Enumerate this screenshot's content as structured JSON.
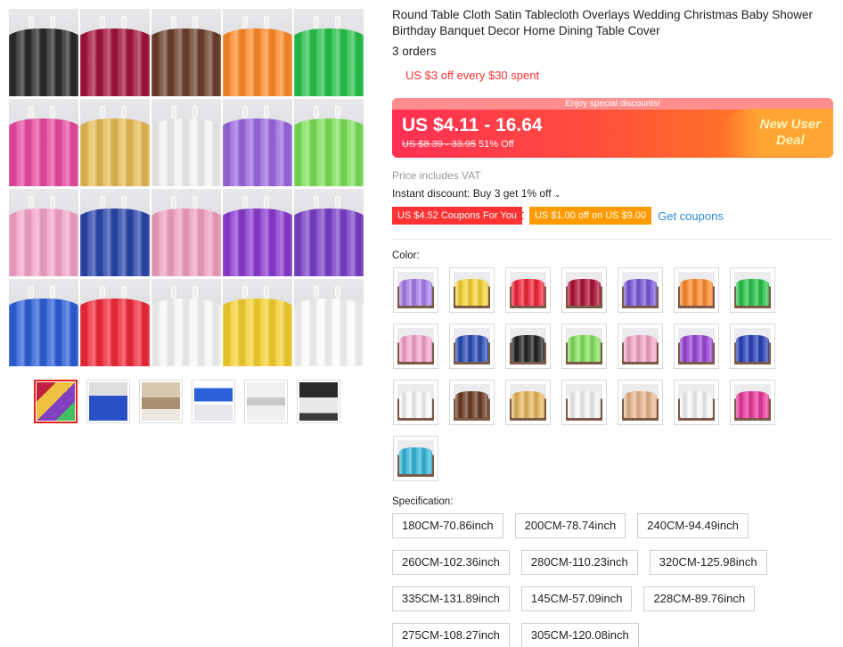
{
  "gallery": {
    "tiles": [
      {
        "color": "#2a2a2a"
      },
      {
        "color": "#a3143a"
      },
      {
        "color": "#6b3f2a"
      },
      {
        "color": "#ff8a2a"
      },
      {
        "color": "#28c04a"
      },
      {
        "color": "#e84a9f"
      },
      {
        "color": "#e6bb55"
      },
      {
        "color": "#f2f2f2"
      },
      {
        "color": "#9a68e0"
      },
      {
        "color": "#7ce05a"
      },
      {
        "color": "#f5a3c8"
      },
      {
        "color": "#2a45a8"
      },
      {
        "color": "#f0a0c0"
      },
      {
        "color": "#8a3ad0"
      },
      {
        "color": "#7a40c8"
      },
      {
        "color": "#2d5fd8"
      },
      {
        "color": "#f02a3a"
      },
      {
        "color": "#f7f7f7"
      },
      {
        "color": "#f5d030"
      },
      {
        "color": "#fafafa"
      }
    ],
    "thumbnails": [
      {
        "name": "thumbnail-color-grid",
        "active": true
      },
      {
        "name": "thumbnail-blue-table"
      },
      {
        "name": "thumbnail-banquet-hall"
      },
      {
        "name": "thumbnail-blue-white-tables"
      },
      {
        "name": "thumbnail-wedding-reception"
      },
      {
        "name": "thumbnail-white-chairs"
      }
    ]
  },
  "product": {
    "title": "Round Table Cloth Satin Tablecloth Overlays Wedding Christmas Baby Shower Birthday Banquet Decor Home Dining Table Cover",
    "orders": "3 orders",
    "promo": "US $3 off every $30 spent"
  },
  "price": {
    "banner_top": "Enjoy special discounts!",
    "current": "US $4.11 - 16.64",
    "original": "US $8.39 - 33.95",
    "discount": "51% Off",
    "new_user": "New User Deal"
  },
  "vat": "Price includes VAT",
  "instant_discount": "Instant discount: Buy 3 get 1% off",
  "coupons": {
    "coupon1": "US $4.52 Coupons For You",
    "coupon2": "US $1.00 off on US $9.00",
    "get": "Get coupons"
  },
  "color_section": {
    "label": "Color:",
    "swatches": [
      "#a680e8",
      "#f7d43a",
      "#f0283c",
      "#b0143a",
      "#7a5ad8",
      "#ff8c2e",
      "#2cc44e",
      "#f5a6cc",
      "#2e4fb6",
      "#262626",
      "#86e060",
      "#f2a8c8",
      "#9a48d8",
      "#2c44b8",
      "#f8f8f8",
      "#6e3e26",
      "#e6b860",
      "#f4f4f4",
      "#e6b890",
      "#f6f6f6",
      "#ea3c9c",
      "#3ab8d8"
    ]
  },
  "spec_section": {
    "label": "Specification:",
    "rows": [
      [
        "180CM-70.86inch",
        "200CM-78.74inch",
        "240CM-94.49inch"
      ],
      [
        "260CM-102.36inch",
        "280CM-110.23inch",
        "320CM-125.98inch"
      ],
      [
        "335CM-131.89inch",
        "145CM-57.09inch",
        "228CM-89.76inch"
      ],
      [
        "275CM-108.27inch",
        "305CM-120.08inch"
      ]
    ]
  }
}
